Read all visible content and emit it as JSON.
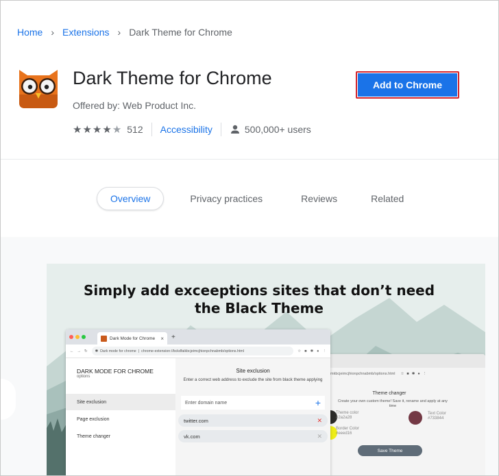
{
  "breadcrumb": {
    "home": "Home",
    "sep1": "›",
    "extensions": "Extensions",
    "sep2": "›",
    "current": "Dark Theme for Chrome"
  },
  "extension": {
    "title": "Dark Theme for Chrome",
    "offered_by": "Offered by: Web Product Inc.",
    "rating_stars": 4.5,
    "rating_count": "512",
    "category": "Accessibility",
    "users": "500,000+ users",
    "add_button": "Add to Chrome"
  },
  "colors": {
    "accent": "#1a73e8",
    "button_outline": "#d3232a",
    "owl_orange": "#e8731c"
  },
  "tabs": [
    {
      "label": "Overview",
      "active": true
    },
    {
      "label": "Privacy practices"
    },
    {
      "label": "Reviews"
    },
    {
      "label": "Related"
    }
  ],
  "slide": {
    "caption_line1": "Simply add exceeptions sites that don’t need",
    "caption_line2": "the Black Theme",
    "window": {
      "tab_title": "Dark Mode for Chrome",
      "tab_close": "×",
      "new_tab": "+",
      "address_prefix": "Dark mode for chrome",
      "address": "chrome-extension://bckdfaikbcjeimcjhionpchnabmb/options.html",
      "sidebar_title": "DARK MODE FOR CHROME",
      "sidebar_subtitle": "options",
      "sidebar_items": [
        "Site exclusion",
        "Page exclusion",
        "Theme changer"
      ],
      "main_title": "Site exclusion",
      "main_desc": "Enter a correct web address to exclude the site from black theme applying",
      "input_placeholder": "Enter domain name",
      "input_add": "+",
      "entries": [
        {
          "domain": "twitter.com",
          "remove": "✕"
        },
        {
          "domain": "vk.com",
          "remove": "✕"
        }
      ]
    },
    "window2": {
      "address": "mkbcjeimcjhionpchnabmb/options.html",
      "title": "Theme changer",
      "desc": "Create your own custom theme! Save it, rename and apply at any time",
      "theme_color_label": "Theme color",
      "theme_color_value": "#2a2a28",
      "text_color_label": "Text Color",
      "text_color_value": "#733844",
      "border_color_label": "Border Color",
      "border_color_value": "#eeed16",
      "save_button": "Save Theme"
    }
  }
}
